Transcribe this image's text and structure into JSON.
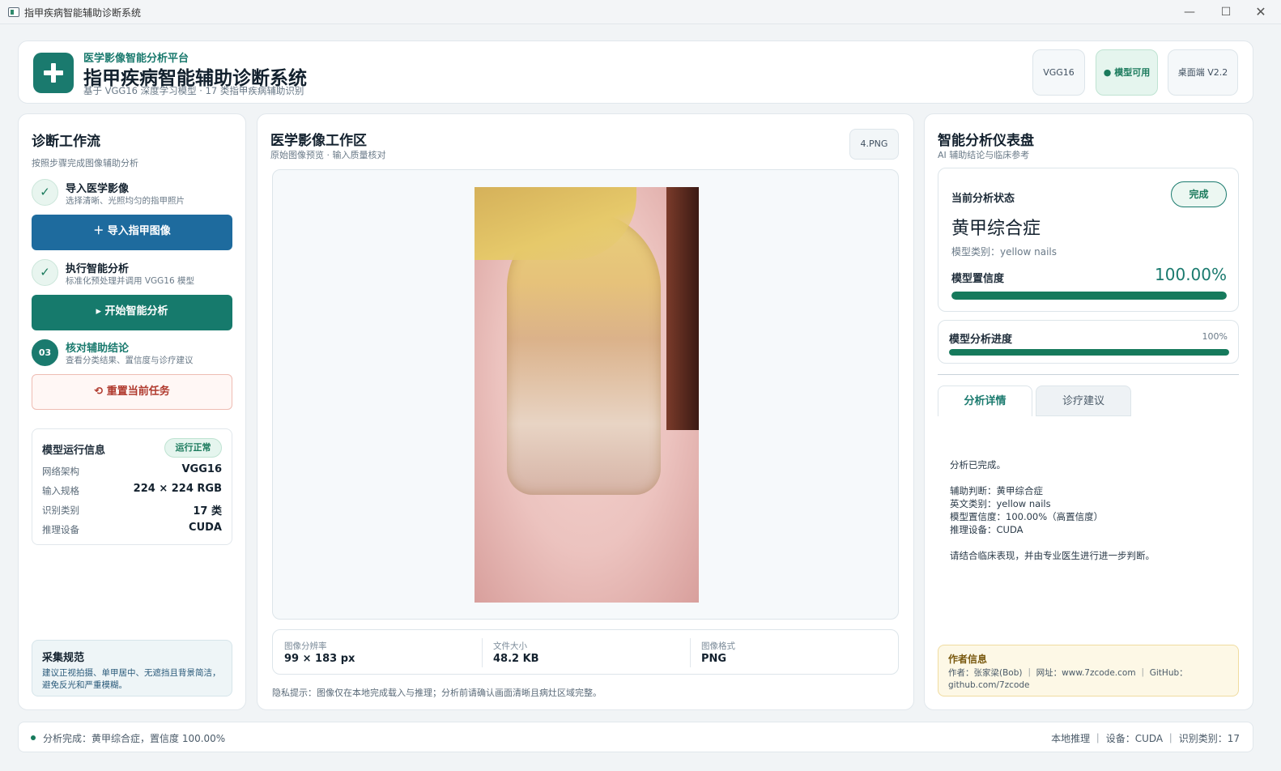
{
  "window": {
    "title": "指甲疾病智能辅助诊断系统",
    "min": "—",
    "max": "☐",
    "close": "✕"
  },
  "header": {
    "subtitle": "医学影像智能分析平台",
    "title": "指甲疾病智能辅助诊断系统",
    "desc": "基于 VGG16 深度学习模型 · 17 类指甲疾病辅助识别",
    "pills": [
      "VGG16",
      "● 模型可用",
      "桌面端 V2.2"
    ]
  },
  "workflow": {
    "title": "诊断工作流",
    "desc": "按照步骤完成图像辅助分析",
    "steps": [
      {
        "icon": "✓",
        "title": "导入医学影像",
        "desc": "选择清晰、光照均匀的指甲照片"
      },
      {
        "icon": "✓",
        "title": "执行智能分析",
        "desc": "标准化预处理并调用 VGG16 模型"
      },
      {
        "icon": "03",
        "title": "核对辅助结论",
        "desc": "查看分类结果、置信度与诊疗建议"
      }
    ],
    "import_btn": "＋  导入指甲图像",
    "analyze_btn": "▸  开始智能分析",
    "reset_btn": "⟲  重置当前任务"
  },
  "model_info": {
    "title": "模型运行信息",
    "badge": "运行正常",
    "rows": [
      {
        "k": "网络架构",
        "v": "VGG16"
      },
      {
        "k": "输入规格",
        "v": "224 × 224 RGB"
      },
      {
        "k": "识别类别",
        "v": "17 类"
      },
      {
        "k": "推理设备",
        "v": "CUDA"
      }
    ]
  },
  "spec": {
    "title": "采集规范",
    "desc": "建议正视拍摄、单甲居中、无遮挡且背景简洁，避免反光和严重模糊。"
  },
  "workspace": {
    "title": "医学影像工作区",
    "desc": "原始图像预览 · 输入质量核对",
    "filename": "4.PNG",
    "meta": [
      {
        "k": "图像分辨率",
        "v": "99 × 183 px"
      },
      {
        "k": "文件大小",
        "v": "48.2 KB"
      },
      {
        "k": "图像格式",
        "v": "PNG"
      }
    ],
    "privacy": "隐私提示：图像仅在本地完成载入与推理；分析前请确认画面清晰且病灶区域完整。"
  },
  "dashboard": {
    "title": "智能分析仪表盘",
    "desc": "AI 辅助结论与临床参考",
    "status_label": "当前分析状态",
    "status_badge": "完成",
    "diagnosis": "黄甲综合症",
    "category": "模型类别：yellow nails",
    "confidence_label": "模型置信度",
    "confidence_text": "100.00%",
    "confidence": 1.0,
    "progress_label": "模型分析进度",
    "progress_text": "100%",
    "progress": 1.0,
    "tabs": [
      "分析详情",
      "诊疗建议"
    ],
    "detail_lines": [
      "分析已完成。",
      "",
      "辅助判断：黄甲综合症",
      "英文类别：yellow nails",
      "模型置信度：100.00%（高置信度）",
      "推理设备：CUDA",
      "",
      "请结合临床表现，并由专业医生进行进一步判断。"
    ]
  },
  "author": {
    "title": "作者信息",
    "desc": "作者：张家梁(Bob) ｜ 网址：www.7zcode.com ｜ GitHub：github.com/7zcode"
  },
  "statusbar": {
    "left": "分析完成：黄甲综合症，置信度 100.00%",
    "right": "本地推理 ｜ 设备：CUDA ｜ 识别类别：17"
  },
  "colors": {
    "primary": "#1a7a6e",
    "blue": "#1e6b9e",
    "danger": "#b03a2e",
    "success": "#167a5c"
  }
}
